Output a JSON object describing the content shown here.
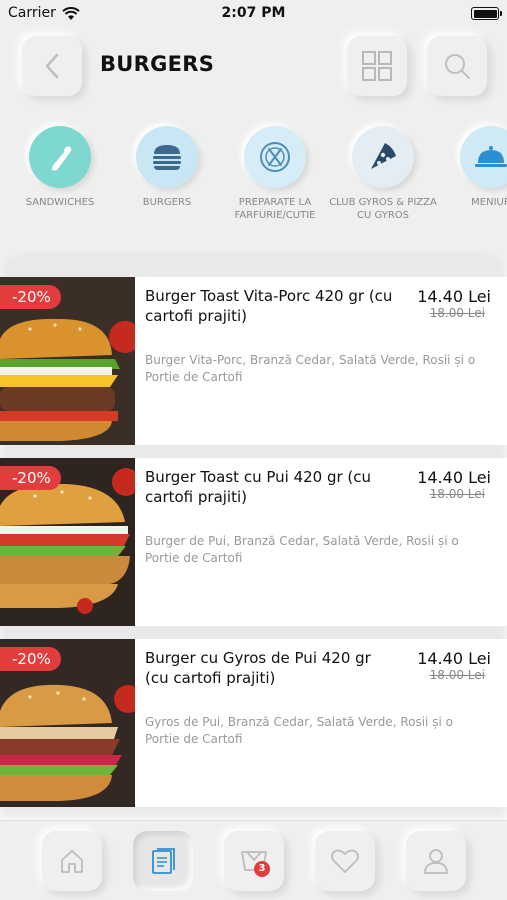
{
  "status_bar": {
    "carrier": "Carrier",
    "time": "2:07 PM"
  },
  "header": {
    "title": "BURGERS",
    "back_icon": "chevron-left-icon",
    "grid_icon": "grid-icon",
    "search_icon": "search-icon"
  },
  "categories": [
    {
      "label": "SANDWICHES",
      "icon": "wrap-icon",
      "color": "#7fd8d0"
    },
    {
      "label": "BURGERS",
      "icon": "burger-icon",
      "color": "#c9e6f4"
    },
    {
      "label": "PREPARATE LA FARFURIE/CUTIE",
      "icon": "plate-cutlery-icon",
      "color": "#d6ecf7"
    },
    {
      "label": "CLUB GYROS & PIZZA CU GYROS",
      "icon": "pizza-icon",
      "color": "#e4edf3"
    },
    {
      "label": "MENIUR",
      "icon": "cloche-icon",
      "color": "#cfe9f5"
    }
  ],
  "products": [
    {
      "discount": "-20%",
      "name": "Burger Toast Vita-Porc 420 gr (cu cartofi prajiti)",
      "description": "Burger Vita-Porc, Branză Cedar, Salată Verde, Rosii și o Portie de Cartofi",
      "price": "14.40 Lei",
      "old_price": "18.00 Lei"
    },
    {
      "discount": "-20%",
      "name": "Burger Toast cu Pui 420 gr (cu cartofi prajiti)",
      "description": "Burger de Pui, Branză Cedar, Salată Verde, Rosii și o Portie de Cartofi",
      "price": "14.40 Lei",
      "old_price": "18.00 Lei"
    },
    {
      "discount": "-20%",
      "name": "Burger cu Gyros de Pui 420 gr (cu cartofi prajiti)",
      "description": "Gyros de Pui, Branză Cedar, Salată Verde, Rosii și o Portie de Cartofi",
      "price": "14.40 Lei",
      "old_price": "18.00 Lei"
    }
  ],
  "tab_bar": {
    "tabs": [
      "home-icon",
      "menu-list-icon",
      "cart-icon",
      "heart-icon",
      "profile-icon"
    ],
    "active_tab": "menu-list-icon",
    "cart_badge": "3",
    "accent": "#2c8fd4"
  }
}
